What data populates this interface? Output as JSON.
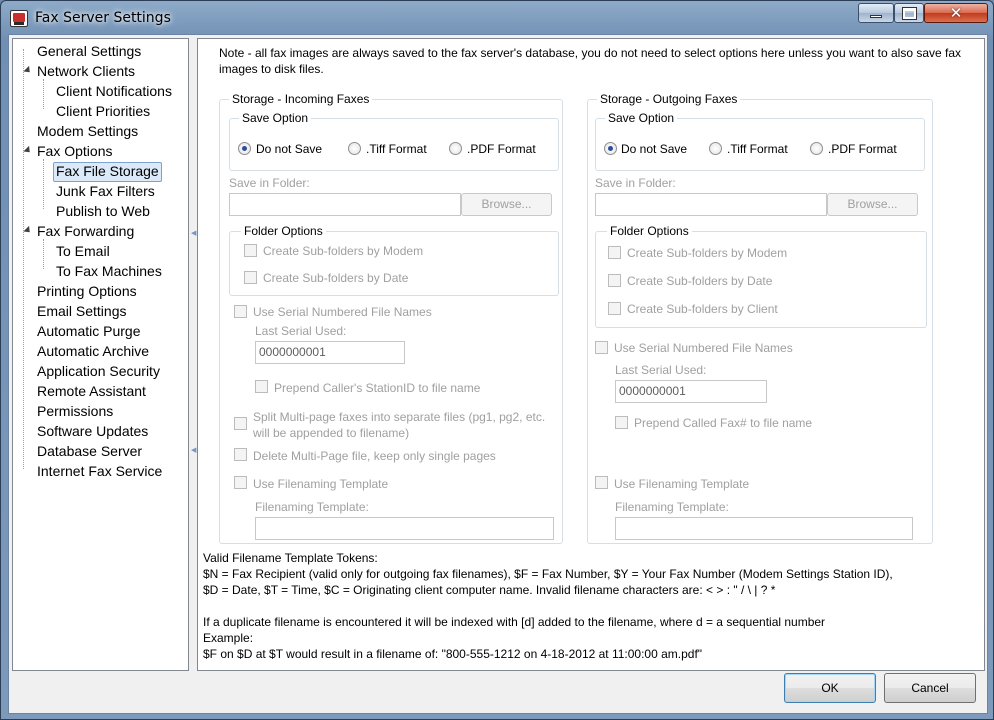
{
  "window": {
    "title": "Fax Server Settings"
  },
  "tree": {
    "items": [
      {
        "label": "General Settings"
      },
      {
        "label": "Network Clients"
      },
      {
        "label": "Client Notifications"
      },
      {
        "label": "Client Priorities"
      },
      {
        "label": "Modem Settings"
      },
      {
        "label": "Fax Options"
      },
      {
        "label": "Fax File Storage"
      },
      {
        "label": "Junk Fax Filters"
      },
      {
        "label": "Publish to Web"
      },
      {
        "label": "Fax Forwarding"
      },
      {
        "label": "To Email"
      },
      {
        "label": "To Fax Machines"
      },
      {
        "label": "Printing Options"
      },
      {
        "label": "Email Settings"
      },
      {
        "label": "Automatic Purge"
      },
      {
        "label": "Automatic Archive"
      },
      {
        "label": "Application Security"
      },
      {
        "label": "Remote Assistant"
      },
      {
        "label": "Permissions"
      },
      {
        "label": "Software Updates"
      },
      {
        "label": "Database Server"
      },
      {
        "label": "Internet Fax Service"
      }
    ],
    "selected": "Fax File Storage"
  },
  "note": "Note - all fax images are always saved to the fax server's database, you do not need to select options here unless you want to also save fax images to disk files.",
  "incoming": {
    "title": "Storage - Incoming Faxes",
    "save_option": "Save Option",
    "radio_none": "Do not Save",
    "radio_tiff": ".Tiff Format",
    "radio_pdf": ".PDF Format",
    "save_in_folder": "Save in Folder:",
    "browse": "Browse...",
    "folder_options": "Folder Options",
    "sub_modem": "Create Sub-folders by Modem",
    "sub_date": "Create Sub-folders by Date",
    "serial": "Use Serial Numbered File Names",
    "last_serial_label": "Last Serial Used:",
    "last_serial_value": "0000000001",
    "prepend": "Prepend Caller's StationID to file name",
    "split": "Split Multi-page faxes into separate files (pg1, pg2, etc. will be appended to filename)",
    "delete_multi": "Delete Multi-Page file, keep only single pages",
    "use_template": "Use Filenaming Template",
    "template_label": "Filenaming Template:"
  },
  "outgoing": {
    "title": "Storage - Outgoing Faxes",
    "save_option": "Save Option",
    "radio_none": "Do not Save",
    "radio_tiff": ".Tiff Format",
    "radio_pdf": ".PDF Format",
    "save_in_folder": "Save in Folder:",
    "browse": "Browse...",
    "folder_options": "Folder Options",
    "sub_modem": "Create Sub-folders by Modem",
    "sub_date": "Create Sub-folders by Date",
    "sub_client": "Create Sub-folders by Client",
    "serial": "Use Serial Numbered File Names",
    "last_serial_label": "Last Serial Used:",
    "last_serial_value": "0000000001",
    "prepend": "Prepend Called Fax# to file name",
    "use_template": "Use Filenaming Template",
    "template_label": "Filenaming Template:"
  },
  "footer": {
    "line1": "Valid Filename Template Tokens:",
    "line2": "$N = Fax Recipient (valid only for outgoing fax filenames),  $F = Fax Number, $Y = Your Fax Number (Modem Settings Station ID),",
    "line3": "$D = Date, $T = Time, $C = Originating client computer name.  Invalid filename characters are:  < > : \" / \\ | ? *",
    "line4": "If a duplicate filename is encountered it will be indexed with [d] added to the filename, where d = a sequential number",
    "line5": "Example:",
    "line6": "$F on $D at $T would result in a filename of: \"800-555-1212 on 4-18-2012 at 11:00:00 am.pdf\""
  },
  "buttons": {
    "ok": "OK",
    "cancel": "Cancel"
  }
}
